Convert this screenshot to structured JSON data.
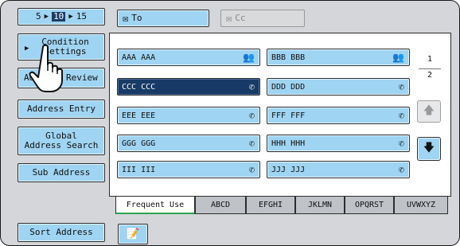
{
  "range": {
    "start": "5",
    "current": "10",
    "end": "15"
  },
  "to": {
    "label": "To"
  },
  "cc": {
    "label": "Cc"
  },
  "left_buttons": {
    "condition_line1": "Condition",
    "condition_line2": "Settings",
    "address_review": "Address Review",
    "address_entry": "Address Entry",
    "global_line1": "Global",
    "global_line2": "Address Search",
    "sub_address": "Sub Address",
    "sort_address": "Sort Address"
  },
  "entries": [
    {
      "name": "AAA AAA",
      "icon": "group-icon"
    },
    {
      "name": "BBB BBB",
      "icon": "group-icon"
    },
    {
      "name": "CCC CCC",
      "icon": "phone-icon",
      "selected": true
    },
    {
      "name": "DDD DDD",
      "icon": "phone-icon"
    },
    {
      "name": "EEE EEE",
      "icon": "phone-icon"
    },
    {
      "name": "FFF FFF",
      "icon": "phone-icon"
    },
    {
      "name": "GGG GGG",
      "icon": "phone-icon"
    },
    {
      "name": "HHH HHH",
      "icon": "phone-icon"
    },
    {
      "name": "III III",
      "icon": "phone-icon"
    },
    {
      "name": "JJJ JJJ",
      "icon": "phone-icon"
    }
  ],
  "pagination": {
    "current": "1",
    "total": "2"
  },
  "tabs": [
    "Frequent Use",
    "ABCD",
    "EFGHI",
    "JKLMN",
    "OPQRST",
    "UVWXYZ"
  ],
  "active_tab": "Frequent Use",
  "colors": {
    "button": "#9fd4f2",
    "selected": "#173a66",
    "panel": "#d4d6d9",
    "active_tab_accent": "#2ea44f"
  }
}
